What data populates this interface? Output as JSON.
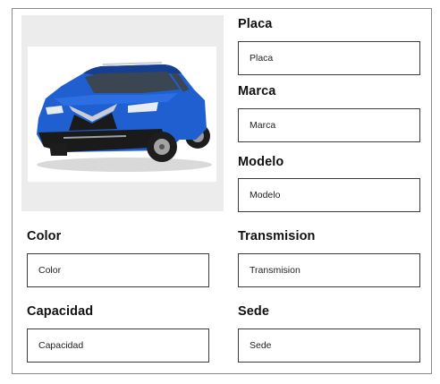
{
  "form": {
    "photo": {
      "alt": "Blue SUV",
      "body_color": "#1f5fd0"
    },
    "fields": {
      "placa": {
        "label": "Placa",
        "placeholder": "Placa"
      },
      "marca": {
        "label": "Marca",
        "placeholder": "Marca"
      },
      "modelo": {
        "label": "Modelo",
        "placeholder": "Modelo"
      },
      "color": {
        "label": "Color",
        "placeholder": "Color"
      },
      "transmision": {
        "label": "Transmision",
        "placeholder": "Transmision"
      },
      "capacidad": {
        "label": "Capacidad",
        "placeholder": "Capacidad"
      },
      "sede": {
        "label": "Sede",
        "placeholder": "Sede"
      }
    }
  }
}
